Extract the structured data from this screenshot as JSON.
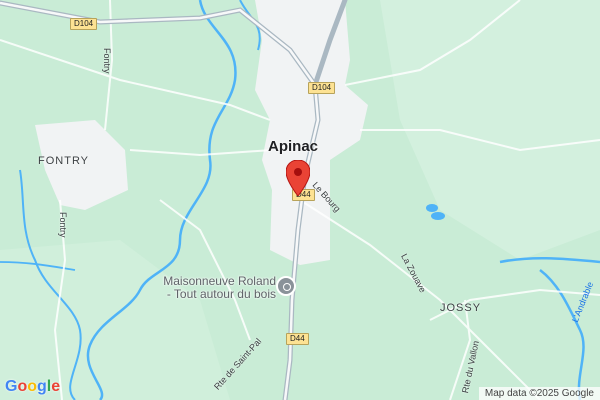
{
  "map": {
    "town": "Apinac",
    "hamlets": [
      "FONTRY",
      "JOSSY"
    ],
    "road_badges": [
      "D104",
      "D104",
      "D44",
      "D44"
    ],
    "streets": {
      "fontry_upper": "Fontry",
      "fontry_lower": "Fontry",
      "le_bourg": "Le Bourg",
      "la_zouave": "La Zouave",
      "rte_saint_pal": "Rte de Saint-Pal",
      "rte_vallon": "Rte du Vallon"
    },
    "water_label": "L'Andrable",
    "poi": {
      "line1": "Maisonneuve Roland",
      "line2": "- Tout autour du bois"
    },
    "attribution": "Map data ©2025 Google",
    "logo_letters": [
      "G",
      "o",
      "o",
      "g",
      "l",
      "e"
    ],
    "colors": {
      "land": "#c9ecd6",
      "urban": "#f1f3f4",
      "water": "#4fb3f7",
      "road": "#aab8c2",
      "marker": "#ea4335",
      "logo": [
        "#4285f4",
        "#ea4335",
        "#fbbc05",
        "#4285f4",
        "#34a853",
        "#ea4335"
      ]
    }
  }
}
